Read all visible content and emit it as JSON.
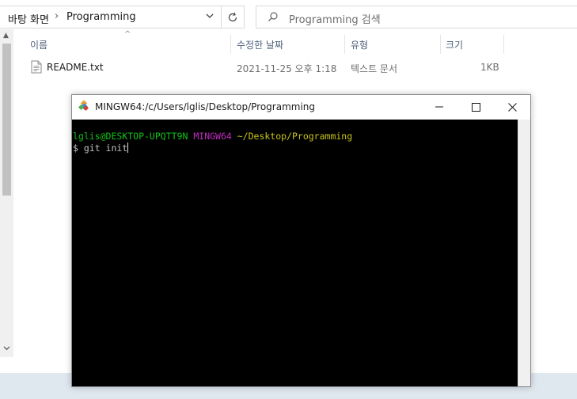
{
  "explorer": {
    "breadcrumb": {
      "parent": "바탕 화면",
      "current": "Programming"
    },
    "search": {
      "placeholder": "Programming 검색"
    },
    "columns": {
      "name": "이름",
      "date": "수정한 날짜",
      "type": "유형",
      "size": "크기"
    },
    "files": [
      {
        "name": "README.txt",
        "date": "2021-11-25 오후 1:18",
        "type": "텍스트 문서",
        "size": "1KB"
      }
    ]
  },
  "terminal": {
    "title": "MINGW64:/c/Users/lglis/Desktop/Programming",
    "prompt": {
      "user_host": "lglis@DESKTOP-UPQTT9N",
      "shell": "MINGW64",
      "path": "~/Desktop/Programming"
    },
    "command_line": "$ git init",
    "colors": {
      "user": "#12c217",
      "shell": "#c22cc2",
      "path": "#c7c41a",
      "background": "#000000"
    }
  }
}
